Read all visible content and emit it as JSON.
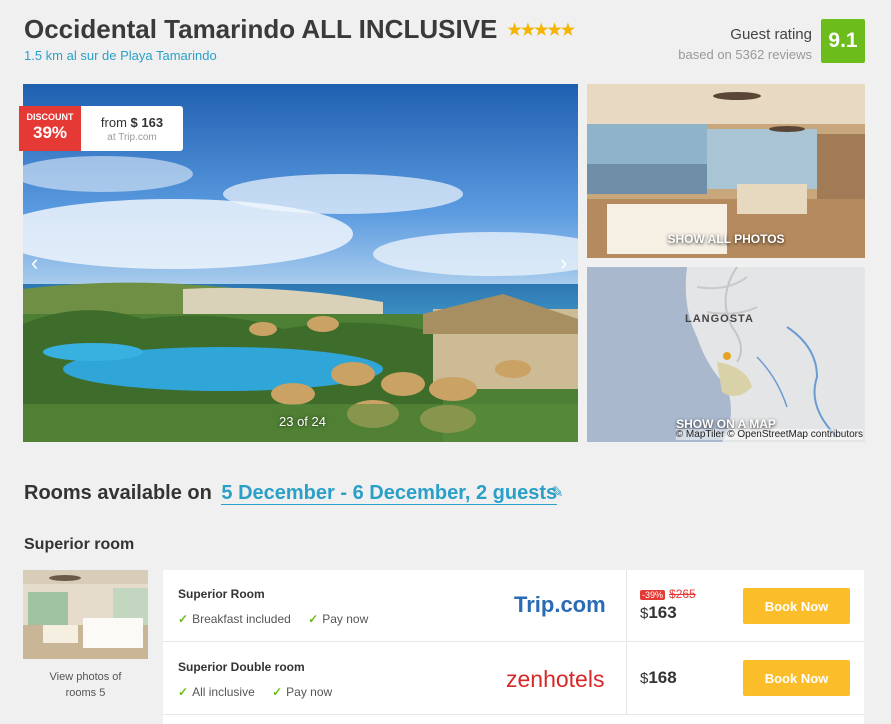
{
  "hotel": {
    "name": "Occidental Tamarindo ALL INCLUSIVE",
    "stars": "★★★★★",
    "location": "1.5 km al sur de Playa Tamarindo"
  },
  "rating": {
    "label": "Guest rating",
    "reviews": "based on 5362 reviews",
    "score": "9.1"
  },
  "gallery": {
    "discount_label": "DISCOUNT",
    "discount_pct": "39%",
    "from_text": "from",
    "from_price": "$ 163",
    "at_text": "at Trip.com",
    "counter": "23 of 24",
    "prev_icon": "‹",
    "next_icon": "›",
    "show_all_photos": "SHOW ALL PHOTOS",
    "map_place": "LANGOSTA",
    "show_on_map": "SHOW ON A MAP",
    "map_credit": "© MapTiler © OpenStreetMap contributors"
  },
  "rooms": {
    "heading": "Rooms available on",
    "dates": "5 December - 6 December, 2 guests",
    "edit_icon": "✎",
    "room_type": "Superior room",
    "thumb_caption_1": "View photos of",
    "thumb_caption_2": "rooms 5"
  },
  "offers": [
    {
      "name": "Superior Room",
      "feature1": "Breakfast included",
      "feature2": "Pay now",
      "provider": "Trip.com",
      "discount": "-39%",
      "old_price": "$265",
      "currency": "$",
      "price": "163",
      "button": "Book Now"
    },
    {
      "name": "Superior Double room",
      "feature1": "All inclusive",
      "feature2": "Pay now",
      "provider": "zenhotels",
      "currency": "$",
      "price": "168",
      "button": "Book Now"
    }
  ],
  "colors": {
    "accent": "#2aa0c8",
    "rating_green": "#6cbc1c",
    "discount_red": "#e53935",
    "book_button": "#fbbd2a"
  }
}
